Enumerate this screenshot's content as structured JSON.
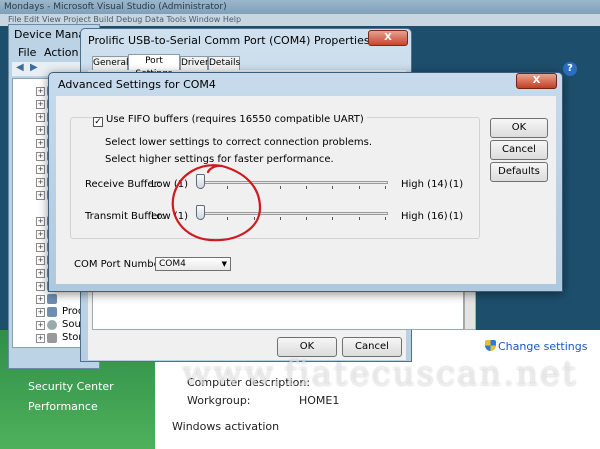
{
  "background": {
    "vs_title": "Mondays - Microsoft Visual Studio (Administrator)",
    "vs_menu": "File  Edit  View  Project  Build  Debug  Data  Tools  Window  Help",
    "control_panel": {
      "links": [
        "Security Center",
        "Performance"
      ],
      "computer_description_label": "Computer description:",
      "workgroup_label": "Workgroup:",
      "workgroup_value": "HOME1",
      "windows_activation_label": "Windows activation",
      "change_settings": "Change settings",
      "help_glyph": "?"
    }
  },
  "device_manager": {
    "title": "Device Mana",
    "menu": [
      "File",
      "Action"
    ],
    "tree_items": [
      "Prod",
      "Sound",
      "Stor"
    ]
  },
  "properties": {
    "title": "Prolific USB-to-Serial Comm Port (COM4) Properties",
    "close_glyph": "X",
    "tabs": [
      "General",
      "Port Settings",
      "Driver",
      "Details"
    ],
    "ok_label": "OK",
    "cancel_label": "Cancel"
  },
  "advanced": {
    "title": "Advanced Settings for COM4",
    "close_glyph": "X",
    "fifo_label": "Use FIFO buffers (requires 16550 compatible UART)",
    "fifo_checked": true,
    "fifo_check_glyph": "✓",
    "note_lower": "Select lower settings to correct connection problems.",
    "note_higher": "Select higher settings for faster performance.",
    "receive": {
      "label": "Receive Buffer:",
      "low": "Low (1)",
      "high": "High (14)",
      "current": "(1)",
      "fraction": 0
    },
    "transmit": {
      "label": "Transmit Buffer:",
      "low": "Low (1)",
      "high": "High (16)",
      "current": "(1)",
      "fraction": 0
    },
    "com_port_label": "COM Port Number:",
    "com_port_value": "COM4",
    "buttons": {
      "ok": "OK",
      "cancel": "Cancel",
      "defaults": "Defaults"
    }
  },
  "watermark": "www.fiatecuscan.net",
  "annotation_color": "#d0181e"
}
